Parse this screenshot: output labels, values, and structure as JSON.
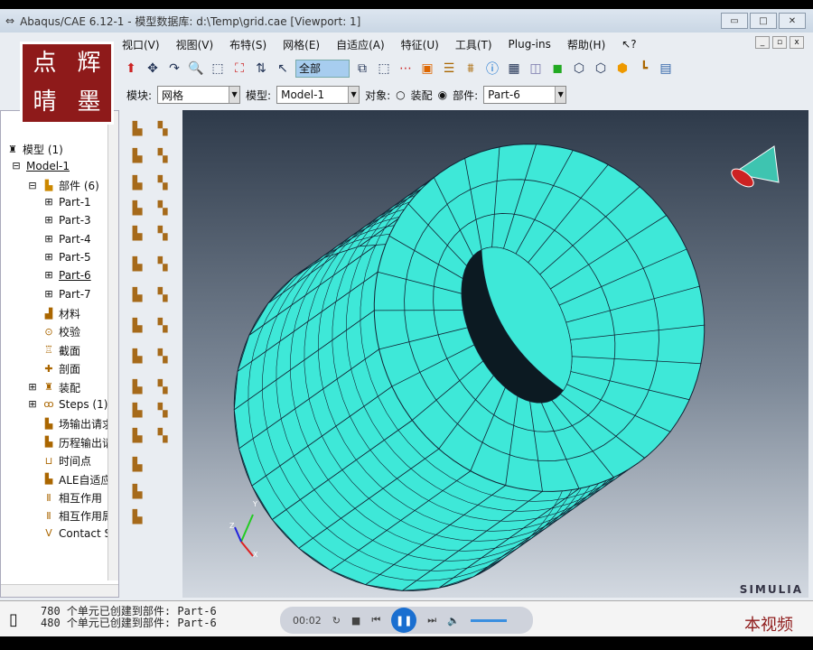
{
  "window": {
    "title": "Abaqus/CAE 6.12-1 - 模型数据库: d:\\Temp\\grid.cae [Viewport: 1]",
    "min": "▭",
    "max": "□",
    "close": "✕"
  },
  "menu": [
    "视口(V)",
    "视图(V)",
    "布特(S)",
    "网格(E)",
    "自适应(A)",
    "特征(U)",
    "工具(T)",
    "Plug-ins",
    "帮助(H)",
    "↖?"
  ],
  "toolbar": {
    "selection": "全部"
  },
  "context": {
    "module_label": "模块:",
    "module": "网格",
    "model_label": "模型:",
    "model": "Model-1",
    "object_label": "对象:",
    "assembly": "装配",
    "part_label": "部件:",
    "part": "Part-6"
  },
  "tree": {
    "root": "模型 (1)",
    "model": "Model-1",
    "parts": "部件 (6)",
    "part_items": [
      "Part-1",
      "Part-3",
      "Part-4",
      "Part-5",
      "Part-6",
      "Part-7"
    ],
    "items": [
      "材料",
      "校验",
      "截面",
      "剖面",
      "装配",
      "Steps (1)",
      "场输出请求",
      "历程输出请",
      "时间点",
      "ALE自适应",
      "相互作用",
      "相互作用属",
      "Contact S"
    ]
  },
  "viewport": {
    "brand": "SIMULIA",
    "triad": {
      "x": "X",
      "y": "Y",
      "z": "Z"
    }
  },
  "messages": [
    "780 个单元已创建到部件: Part-6",
    "480 个单元已创建到部件: Part-6"
  ],
  "player": {
    "time": "00:02"
  },
  "watermark": {
    "seal": [
      "点",
      "辉",
      "晴",
      "墨"
    ],
    "corner": "本视频"
  },
  "colors": {
    "mesh": "#3ee8d8",
    "accent": "#a7cdef"
  }
}
